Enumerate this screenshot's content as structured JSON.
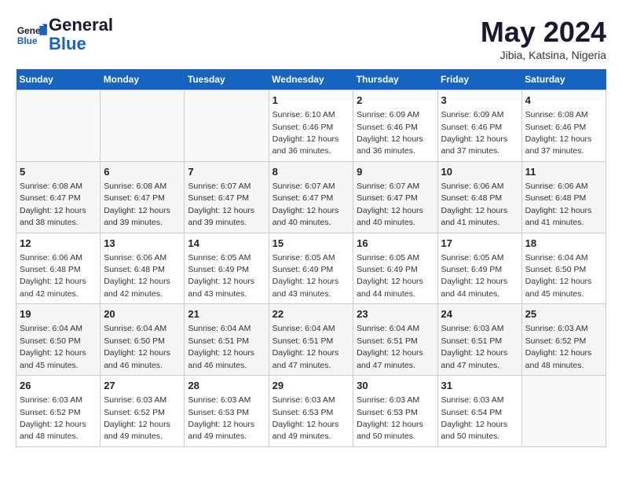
{
  "header": {
    "logo_general": "General",
    "logo_blue": "Blue",
    "month_year": "May 2024",
    "location": "Jibia, Katsina, Nigeria"
  },
  "days_of_week": [
    "Sunday",
    "Monday",
    "Tuesday",
    "Wednesday",
    "Thursday",
    "Friday",
    "Saturday"
  ],
  "weeks": [
    [
      {
        "day": "",
        "sunrise": "",
        "sunset": "",
        "daylight": ""
      },
      {
        "day": "",
        "sunrise": "",
        "sunset": "",
        "daylight": ""
      },
      {
        "day": "",
        "sunrise": "",
        "sunset": "",
        "daylight": ""
      },
      {
        "day": "1",
        "sunrise": "Sunrise: 6:10 AM",
        "sunset": "Sunset: 6:46 PM",
        "daylight": "Daylight: 12 hours and 36 minutes."
      },
      {
        "day": "2",
        "sunrise": "Sunrise: 6:09 AM",
        "sunset": "Sunset: 6:46 PM",
        "daylight": "Daylight: 12 hours and 36 minutes."
      },
      {
        "day": "3",
        "sunrise": "Sunrise: 6:09 AM",
        "sunset": "Sunset: 6:46 PM",
        "daylight": "Daylight: 12 hours and 37 minutes."
      },
      {
        "day": "4",
        "sunrise": "Sunrise: 6:08 AM",
        "sunset": "Sunset: 6:46 PM",
        "daylight": "Daylight: 12 hours and 37 minutes."
      }
    ],
    [
      {
        "day": "5",
        "sunrise": "Sunrise: 6:08 AM",
        "sunset": "Sunset: 6:47 PM",
        "daylight": "Daylight: 12 hours and 38 minutes."
      },
      {
        "day": "6",
        "sunrise": "Sunrise: 6:08 AM",
        "sunset": "Sunset: 6:47 PM",
        "daylight": "Daylight: 12 hours and 39 minutes."
      },
      {
        "day": "7",
        "sunrise": "Sunrise: 6:07 AM",
        "sunset": "Sunset: 6:47 PM",
        "daylight": "Daylight: 12 hours and 39 minutes."
      },
      {
        "day": "8",
        "sunrise": "Sunrise: 6:07 AM",
        "sunset": "Sunset: 6:47 PM",
        "daylight": "Daylight: 12 hours and 40 minutes."
      },
      {
        "day": "9",
        "sunrise": "Sunrise: 6:07 AM",
        "sunset": "Sunset: 6:47 PM",
        "daylight": "Daylight: 12 hours and 40 minutes."
      },
      {
        "day": "10",
        "sunrise": "Sunrise: 6:06 AM",
        "sunset": "Sunset: 6:48 PM",
        "daylight": "Daylight: 12 hours and 41 minutes."
      },
      {
        "day": "11",
        "sunrise": "Sunrise: 6:06 AM",
        "sunset": "Sunset: 6:48 PM",
        "daylight": "Daylight: 12 hours and 41 minutes."
      }
    ],
    [
      {
        "day": "12",
        "sunrise": "Sunrise: 6:06 AM",
        "sunset": "Sunset: 6:48 PM",
        "daylight": "Daylight: 12 hours and 42 minutes."
      },
      {
        "day": "13",
        "sunrise": "Sunrise: 6:06 AM",
        "sunset": "Sunset: 6:48 PM",
        "daylight": "Daylight: 12 hours and 42 minutes."
      },
      {
        "day": "14",
        "sunrise": "Sunrise: 6:05 AM",
        "sunset": "Sunset: 6:49 PM",
        "daylight": "Daylight: 12 hours and 43 minutes."
      },
      {
        "day": "15",
        "sunrise": "Sunrise: 6:05 AM",
        "sunset": "Sunset: 6:49 PM",
        "daylight": "Daylight: 12 hours and 43 minutes."
      },
      {
        "day": "16",
        "sunrise": "Sunrise: 6:05 AM",
        "sunset": "Sunset: 6:49 PM",
        "daylight": "Daylight: 12 hours and 44 minutes."
      },
      {
        "day": "17",
        "sunrise": "Sunrise: 6:05 AM",
        "sunset": "Sunset: 6:49 PM",
        "daylight": "Daylight: 12 hours and 44 minutes."
      },
      {
        "day": "18",
        "sunrise": "Sunrise: 6:04 AM",
        "sunset": "Sunset: 6:50 PM",
        "daylight": "Daylight: 12 hours and 45 minutes."
      }
    ],
    [
      {
        "day": "19",
        "sunrise": "Sunrise: 6:04 AM",
        "sunset": "Sunset: 6:50 PM",
        "daylight": "Daylight: 12 hours and 45 minutes."
      },
      {
        "day": "20",
        "sunrise": "Sunrise: 6:04 AM",
        "sunset": "Sunset: 6:50 PM",
        "daylight": "Daylight: 12 hours and 46 minutes."
      },
      {
        "day": "21",
        "sunrise": "Sunrise: 6:04 AM",
        "sunset": "Sunset: 6:51 PM",
        "daylight": "Daylight: 12 hours and 46 minutes."
      },
      {
        "day": "22",
        "sunrise": "Sunrise: 6:04 AM",
        "sunset": "Sunset: 6:51 PM",
        "daylight": "Daylight: 12 hours and 47 minutes."
      },
      {
        "day": "23",
        "sunrise": "Sunrise: 6:04 AM",
        "sunset": "Sunset: 6:51 PM",
        "daylight": "Daylight: 12 hours and 47 minutes."
      },
      {
        "day": "24",
        "sunrise": "Sunrise: 6:03 AM",
        "sunset": "Sunset: 6:51 PM",
        "daylight": "Daylight: 12 hours and 47 minutes."
      },
      {
        "day": "25",
        "sunrise": "Sunrise: 6:03 AM",
        "sunset": "Sunset: 6:52 PM",
        "daylight": "Daylight: 12 hours and 48 minutes."
      }
    ],
    [
      {
        "day": "26",
        "sunrise": "Sunrise: 6:03 AM",
        "sunset": "Sunset: 6:52 PM",
        "daylight": "Daylight: 12 hours and 48 minutes."
      },
      {
        "day": "27",
        "sunrise": "Sunrise: 6:03 AM",
        "sunset": "Sunset: 6:52 PM",
        "daylight": "Daylight: 12 hours and 49 minutes."
      },
      {
        "day": "28",
        "sunrise": "Sunrise: 6:03 AM",
        "sunset": "Sunset: 6:53 PM",
        "daylight": "Daylight: 12 hours and 49 minutes."
      },
      {
        "day": "29",
        "sunrise": "Sunrise: 6:03 AM",
        "sunset": "Sunset: 6:53 PM",
        "daylight": "Daylight: 12 hours and 49 minutes."
      },
      {
        "day": "30",
        "sunrise": "Sunrise: 6:03 AM",
        "sunset": "Sunset: 6:53 PM",
        "daylight": "Daylight: 12 hours and 50 minutes."
      },
      {
        "day": "31",
        "sunrise": "Sunrise: 6:03 AM",
        "sunset": "Sunset: 6:54 PM",
        "daylight": "Daylight: 12 hours and 50 minutes."
      },
      {
        "day": "",
        "sunrise": "",
        "sunset": "",
        "daylight": ""
      }
    ]
  ]
}
